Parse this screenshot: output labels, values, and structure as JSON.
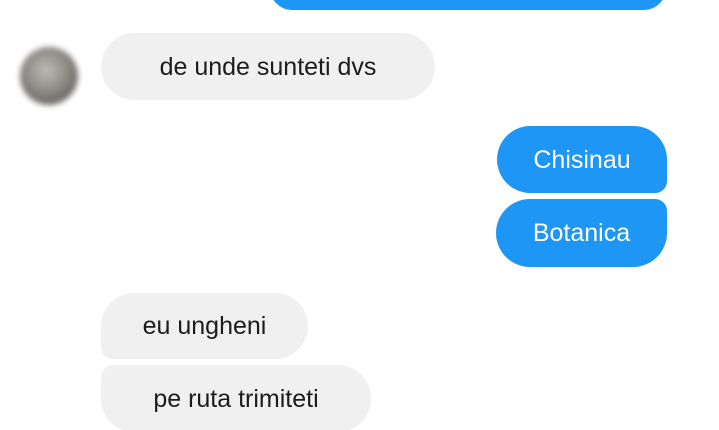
{
  "colors": {
    "incoming_bubble": "#f1f0f0",
    "outgoing_bubble": "#1e96f5",
    "incoming_text": "#1c1c1c",
    "outgoing_text": "#ffffff"
  },
  "messages": [
    {
      "direction": "outgoing",
      "text": ""
    },
    {
      "direction": "incoming",
      "text": "de unde sunteti dvs"
    },
    {
      "direction": "outgoing",
      "text": "Chisinau"
    },
    {
      "direction": "outgoing",
      "text": "Botanica"
    },
    {
      "direction": "incoming",
      "text": "eu ungheni"
    },
    {
      "direction": "incoming",
      "text": "pe ruta trimiteti"
    }
  ]
}
